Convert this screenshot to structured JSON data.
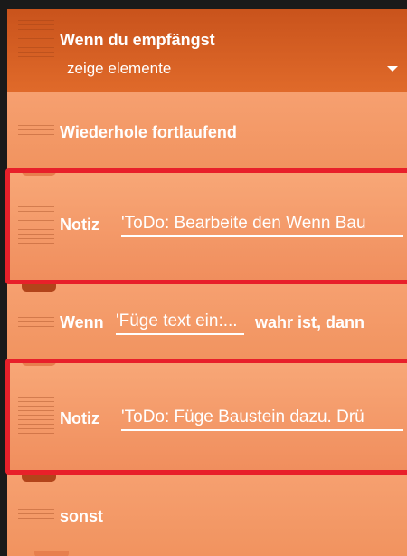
{
  "event_block": {
    "title": "Wenn du empfängst",
    "dropdown_value": "zeige elemente",
    "dropdown_icon": "caret-down-icon"
  },
  "loop_block": {
    "label": "Wiederhole fortlaufend"
  },
  "note_block_1": {
    "label": "Notiz",
    "value": "'ToDo: Bearbeite den Wenn Bau"
  },
  "condition_block": {
    "label": "Wenn",
    "value": "'Füge text ein:...",
    "suffix": "wahr ist, dann"
  },
  "note_block_2": {
    "label": "Notiz",
    "value": "'ToDo: Füge Baustein dazu. Drü"
  },
  "else_block": {
    "label": "sonst"
  },
  "colors": {
    "event_block": "#d25a20",
    "control_block": "#f39a68",
    "highlight": "#e8202a",
    "text": "#ffffff"
  }
}
